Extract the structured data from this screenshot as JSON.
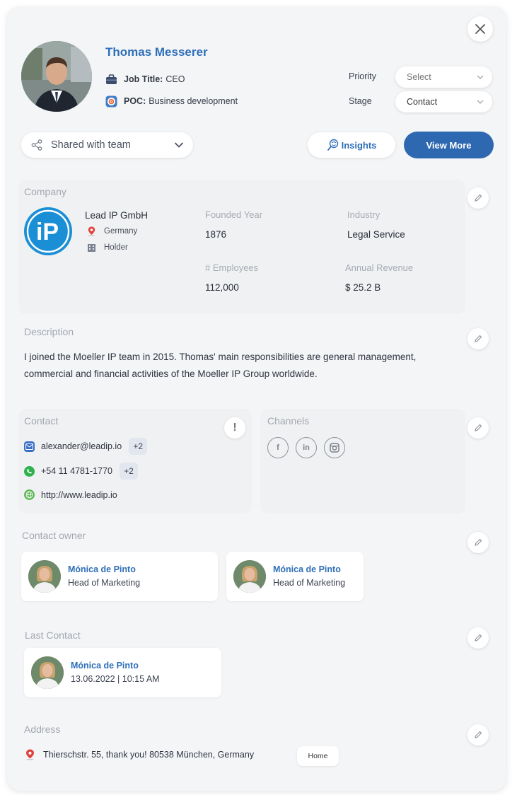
{
  "header": {
    "name": "Thomas Messerer",
    "job_title_label": "Job Title:",
    "job_title_value": "CEO",
    "poc_label": "POC:",
    "poc_value": "Business development",
    "priority_label": "Priority",
    "priority_value": "Select",
    "stage_label": "Stage",
    "stage_value": "Contact",
    "close_icon": "close-icon"
  },
  "actions": {
    "shared_label": "Shared with team",
    "insights_label": "Insights",
    "view_more_label": "View More"
  },
  "company": {
    "section_title": "Company",
    "logo_text": "iP",
    "name": "Lead IP GmbH",
    "country": "Germany",
    "type": "Holder",
    "founded_label": "Founded Year",
    "founded_value": "1876",
    "industry_label": "Industry",
    "industry_value": "Legal Service",
    "employees_label": "# Employees",
    "employees_value": "112,000",
    "revenue_label": "Annual Revenue",
    "revenue_value": "$ 25.2 B"
  },
  "description": {
    "section_title": "Description",
    "text": "I joined the Moeller IP team in 2015. Thomas' main responsibilities are general management, commercial and financial activities of the Moeller IP Group worldwide."
  },
  "contact": {
    "section_title": "Contact",
    "email": "alexander@leadip.io",
    "email_extra": "+2",
    "phone": "+54 11 4781-1770",
    "phone_extra": "+2",
    "website": "http://www.leadip.io",
    "info_glyph": "!"
  },
  "channels": {
    "section_title": "Channels",
    "items": [
      "f",
      "in",
      "ig"
    ]
  },
  "contact_owner": {
    "section_title": "Contact owner",
    "owners": [
      {
        "name": "Mónica de Pinto",
        "role": "Head of Marketing"
      },
      {
        "name": "Mónica de Pinto",
        "role": "Head of Marketing"
      }
    ]
  },
  "last_contact": {
    "section_title": "Last Contact",
    "name": "Mónica de Pinto",
    "datetime": "13.06.2022 | 10:15 AM"
  },
  "address": {
    "section_title": "Address",
    "text": "Thierschstr. 55, thank you! 80538 München, Germany",
    "tag": "Home"
  },
  "colors": {
    "accent": "#2f6fb8",
    "primary_button": "#2e68b0",
    "logo_blue": "#1b8fd6"
  }
}
